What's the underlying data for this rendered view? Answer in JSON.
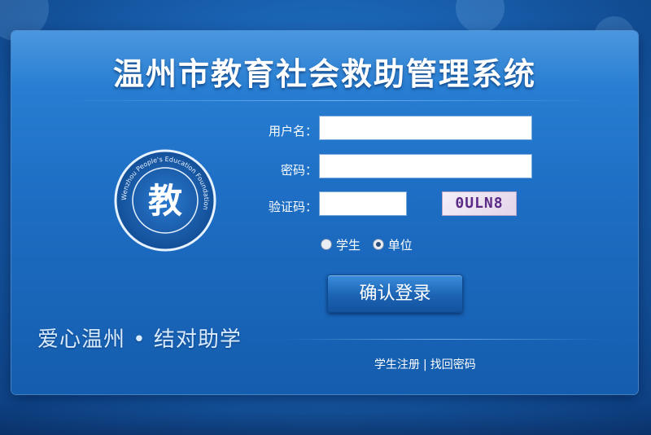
{
  "title": "温州市教育社会救助管理系统",
  "form": {
    "username_label": "用户名：",
    "password_label": "密码：",
    "captcha_label": "验证码：",
    "username_value": "",
    "password_value": "",
    "captcha_value": "",
    "captcha_image_text": "0ULN8"
  },
  "user_type": {
    "options": [
      "学生",
      "单位"
    ],
    "selected": "单位"
  },
  "login_button": "确认登录",
  "slogan": "爱心温州 • 结对助学",
  "links": {
    "register": "学生注册",
    "separator": "|",
    "recover": "找回密码"
  },
  "logo": {
    "emblem_char": "教",
    "ring_text": "Wenzhou People's Education Foundation"
  },
  "colors": {
    "background": "#1a63b3",
    "panel": "#1d6ec4",
    "captcha_text": "#5a2a86"
  }
}
